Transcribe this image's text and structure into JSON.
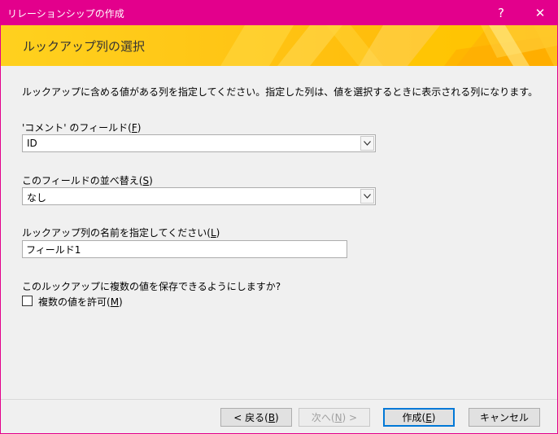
{
  "window": {
    "title": "リレーションシップの作成",
    "help_glyph": "?",
    "close_glyph": "✕"
  },
  "banner": {
    "heading": "ルックアップ列の選択"
  },
  "instructions": "ルックアップに含める値がある列を指定してください。指定した列は、値を選択するときに表示される列になります。",
  "field_select": {
    "label_prefix": "'コメント' のフィールド(",
    "label_key": "F",
    "label_suffix": ")",
    "value": "ID"
  },
  "sort_select": {
    "label_prefix": "このフィールドの並べ替え(",
    "label_key": "S",
    "label_suffix": ")",
    "value": "なし"
  },
  "lookup_name": {
    "label_prefix": "ルックアップ列の名前を指定してください(",
    "label_key": "L",
    "label_suffix": ")",
    "value": "フィールド1"
  },
  "multi_values": {
    "question": "このルックアップに複数の値を保存できるようにしますか?",
    "label_prefix": "複数の値を許可(",
    "label_key": "M",
    "label_suffix": ")",
    "checked": false
  },
  "buttons": {
    "back": {
      "prefix": "< 戻る(",
      "key": "B",
      "suffix": ")"
    },
    "next": {
      "prefix": "次へ(",
      "key": "N",
      "suffix": ") >"
    },
    "create": {
      "prefix": "作成(",
      "key": "E",
      "suffix": ")"
    },
    "cancel": {
      "label": "キャンセル"
    }
  },
  "colors": {
    "titlebar": "#e3008c",
    "banner": "#ffc414",
    "default_button_border": "#0078d7"
  },
  "icons": {
    "help": "help-icon",
    "close": "close-icon",
    "dropdown": "chevron-down-icon"
  }
}
